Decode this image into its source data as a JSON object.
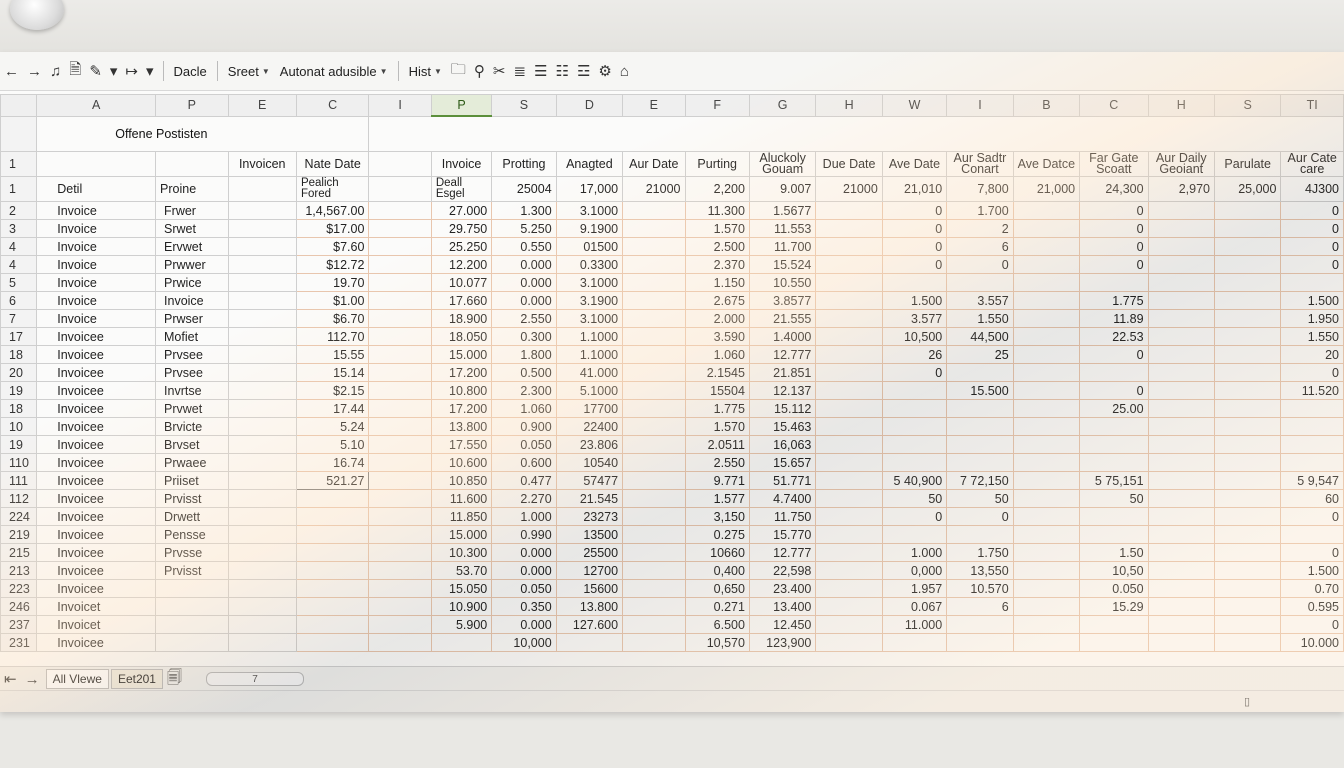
{
  "toolbar": {
    "items": [
      {
        "name": "back-icon",
        "glyph": "←",
        "kind": "icon"
      },
      {
        "name": "forward-icon",
        "glyph": "→",
        "kind": "icon"
      },
      {
        "name": "brush-icon",
        "glyph": "♫",
        "kind": "icon"
      },
      {
        "name": "save-icon",
        "glyph": "🗎",
        "kind": "icon"
      },
      {
        "name": "paint-icon",
        "glyph": "✎",
        "kind": "icon"
      },
      {
        "name": "dropdown-caret-icon",
        "glyph": "▾",
        "kind": "icon"
      },
      {
        "name": "redo-icon",
        "glyph": "↦",
        "kind": "icon"
      },
      {
        "name": "dropdown-caret-icon",
        "glyph": "▾",
        "kind": "icon"
      }
    ],
    "dacle_label": "Dacle",
    "sreet_label": "Sreet",
    "format_label": "Autonat adusible",
    "hist_label": "Hist",
    "icons2": [
      {
        "name": "folder-icon",
        "glyph": "🗀"
      },
      {
        "name": "zoom-icon",
        "glyph": "⚲"
      },
      {
        "name": "clear-icon",
        "glyph": "✂"
      },
      {
        "name": "align-icon",
        "glyph": "≣"
      },
      {
        "name": "list-icon",
        "glyph": "☰"
      },
      {
        "name": "bullets-icon",
        "glyph": "☷"
      },
      {
        "name": "outline-icon",
        "glyph": "☲"
      },
      {
        "name": "link-icon",
        "glyph": "⚙"
      },
      {
        "name": "home-icon",
        "glyph": "⌂"
      }
    ]
  },
  "columns": [
    "A",
    "P",
    "E",
    "C",
    "I",
    "P",
    "S",
    "D",
    "E",
    "F",
    "G",
    "H",
    "W",
    "I",
    "B",
    "C",
    "H",
    "S",
    "TI"
  ],
  "title": "Offene Postisten",
  "header_row": {
    "rownum": "1",
    "cells": [
      "",
      "",
      "Invoicen",
      "Nate Date",
      "",
      "Invoice",
      "Protting",
      "Anagted",
      "Aur Date",
      "Purting",
      "Aluckoly Gouam",
      "Due Date",
      "Ave Date",
      "Aur Sadtr Conart",
      "Ave Datce",
      "Far Gate Scoatt",
      "Aur Daily Geoiant",
      "Parulate",
      "Aur Cate care"
    ]
  },
  "sub_row": {
    "rownum": "1",
    "cells": [
      "Detil",
      "Proine",
      "",
      "Pealich Fored",
      "",
      "Deall Esgel",
      "25004",
      "17,000",
      "21000",
      "2,200",
      "9.007",
      "21000",
      "21,010",
      "7,800",
      "21,000",
      "24,300",
      "2,970",
      "25,000",
      "4J300"
    ]
  },
  "rows": [
    {
      "n": "2",
      "c": [
        "Invoice",
        "Frwer",
        "",
        "1,4,567.00",
        "",
        "27.000",
        "1.300",
        "3.1000",
        "",
        "11.300",
        "1.5677",
        "",
        "0",
        "1.700",
        "",
        "0",
        "",
        "",
        "0"
      ]
    },
    {
      "n": "3",
      "c": [
        "Invoice",
        "Srwet",
        "",
        "$17.00",
        "",
        "29.750",
        "5.250",
        "9.1900",
        "",
        "1.570",
        "11.553",
        "",
        "0",
        "2",
        "",
        "0",
        "",
        "",
        "0"
      ]
    },
    {
      "n": "4",
      "c": [
        "Invoice",
        "Ervwet",
        "",
        "$7.60",
        "",
        "25.250",
        "0.550",
        "01500",
        "",
        "2.500",
        "11.700",
        "",
        "0",
        "6",
        "",
        "0",
        "",
        "",
        "0"
      ]
    },
    {
      "n": "4",
      "c": [
        "Invoice",
        "Prwwer",
        "",
        "$12.72",
        "",
        "12.200",
        "0.000",
        "0.3300",
        "",
        "2.370",
        "15.524",
        "",
        "0",
        "0",
        "",
        "0",
        "",
        "",
        "0"
      ]
    },
    {
      "n": "5",
      "c": [
        "Invoice",
        "Prwice",
        "",
        "19.70",
        "",
        "10.077",
        "0.000",
        "3.1000",
        "",
        "1.150",
        "10.550",
        "",
        "",
        "",
        "",
        "",
        "",
        "",
        ""
      ]
    },
    {
      "n": "6",
      "c": [
        "Invoice",
        "Invoice",
        "",
        "$1.00",
        "",
        "17.660",
        "0.000",
        "3.1900",
        "",
        "2.675",
        "3.8577",
        "",
        "1.500",
        "3.557",
        "",
        "1.775",
        "",
        "",
        "1.500"
      ]
    },
    {
      "n": "7",
      "c": [
        "Invoice",
        "Prwser",
        "",
        "$6.70",
        "",
        "18.900",
        "2.550",
        "3.1000",
        "",
        "2.000",
        "21.555",
        "",
        "3.577",
        "1.550",
        "",
        "11.89",
        "",
        "",
        "1.950"
      ]
    },
    {
      "n": "17",
      "c": [
        "Invoicee",
        "Mofiet",
        "",
        "112.70",
        "",
        "18.050",
        "0.300",
        "1.1000",
        "",
        "3.590",
        "1.4000",
        "",
        "10,500",
        "44,500",
        "",
        "22.53",
        "",
        "",
        "1.550"
      ]
    },
    {
      "n": "18",
      "c": [
        "Invoicee",
        "Prvsee",
        "",
        "15.55",
        "",
        "15.000",
        "1.800",
        "1.1000",
        "",
        "1.060",
        "12.777",
        "",
        "26",
        "25",
        "",
        "0",
        "",
        "",
        "20"
      ]
    },
    {
      "n": "20",
      "c": [
        "Invoicee",
        "Prvsee",
        "",
        "15.14",
        "",
        "17.200",
        "0.500",
        "41.000",
        "",
        "2.1545",
        "21.851",
        "",
        "0",
        "",
        "",
        "",
        "",
        "",
        "0"
      ]
    },
    {
      "n": "19",
      "c": [
        "Invoicee",
        "Invrtse",
        "",
        "$2.15",
        "",
        "10.800",
        "2.300",
        "5.1000",
        "",
        "15504",
        "12.137",
        "",
        "",
        "15.500",
        "",
        "0",
        "",
        "",
        "11.520"
      ]
    },
    {
      "n": "18",
      "c": [
        "Invoicee",
        "Prvwet",
        "",
        "17.44",
        "",
        "17.200",
        "1.060",
        "17700",
        "",
        "1.775",
        "15.112",
        "",
        "",
        "",
        "",
        "25.00",
        "",
        "",
        ""
      ]
    },
    {
      "n": "10",
      "c": [
        "Invoicee",
        "Brvicte",
        "",
        "5.24",
        "",
        "13.800",
        "0.900",
        "22400",
        "",
        "1.570",
        "15.463",
        "",
        "",
        "",
        "",
        "",
        "",
        "",
        ""
      ]
    },
    {
      "n": "19",
      "c": [
        "Invoicee",
        "Brvset",
        "",
        "5.10",
        "",
        "17.550",
        "0.050",
        "23.806",
        "",
        "2.0511",
        "16,063",
        "",
        "",
        "",
        "",
        "",
        "",
        "",
        ""
      ]
    },
    {
      "n": "110",
      "c": [
        "Invoicee",
        "Prwaee",
        "",
        "16.74",
        "",
        "10.600",
        "0.600",
        "10540",
        "",
        "2.550",
        "15.657",
        "",
        "",
        "",
        "",
        "",
        "",
        "",
        ""
      ]
    },
    {
      "n": "111",
      "c": [
        "Invoicee",
        "Priiset",
        "",
        "521.27",
        "",
        "10.850",
        "0.477",
        "57477",
        "",
        "9.771",
        "51.771",
        "",
        "5  40,900",
        "7  72,150",
        "",
        "5  75,151",
        "",
        "",
        "5  9,547"
      ]
    },
    {
      "n": "112",
      "c": [
        "Invoicee",
        "Prvisst",
        "",
        "",
        "",
        "11.600",
        "2.270",
        "21.545",
        "",
        "1.577",
        "4.7400",
        "",
        "50",
        "50",
        "",
        "50",
        "",
        "",
        "60"
      ]
    },
    {
      "n": "224",
      "c": [
        "Invoicee",
        "Drwett",
        "",
        "",
        "",
        "11.850",
        "1.000",
        "23273",
        "",
        "3,150",
        "11.750",
        "",
        "0",
        "0",
        "",
        "",
        "",
        "",
        "0"
      ]
    },
    {
      "n": "219",
      "c": [
        "Invoicee",
        "Pensse",
        "",
        "",
        "",
        "15.000",
        "0.990",
        "13500",
        "",
        "0.275",
        "15.770",
        "",
        "",
        "",
        "",
        "",
        "",
        "",
        ""
      ]
    },
    {
      "n": "215",
      "c": [
        "Invoicee",
        "Prvsse",
        "",
        "",
        "",
        "10.300",
        "0.000",
        "25500",
        "",
        "10660",
        "12.777",
        "",
        "1.000",
        "1.750",
        "",
        "1.50",
        "",
        "",
        "0"
      ]
    },
    {
      "n": "213",
      "c": [
        "Invoicee",
        "Prvisst",
        "",
        "",
        "",
        "53.70",
        "0.000",
        "12700",
        "",
        "0,400",
        "22,598",
        "",
        "0,000",
        "13,550",
        "",
        "10,50",
        "",
        "",
        "1.500"
      ]
    },
    {
      "n": "223",
      "c": [
        "Invoicee",
        "",
        "",
        "",
        "",
        "15.050",
        "0.050",
        "15600",
        "",
        "0,650",
        "23.400",
        "",
        "1.957",
        "10.570",
        "",
        "0.050",
        "",
        "",
        "0.70"
      ]
    },
    {
      "n": "246",
      "c": [
        "Invoicet",
        "",
        "",
        "",
        "",
        "10.900",
        "0.350",
        "13.800",
        "",
        "0.271",
        "13.400",
        "",
        "0.067",
        "6",
        "",
        "15.29",
        "",
        "",
        "0.595"
      ]
    },
    {
      "n": "237",
      "c": [
        "Invoicet",
        "",
        "",
        "",
        "",
        "5.900",
        "0.000",
        "127.600",
        "",
        "6.500",
        "12.450",
        "",
        "11.000",
        "",
        "",
        "",
        "",
        "",
        "0"
      ]
    },
    {
      "n": "231",
      "c": [
        "Invoicee",
        "",
        "",
        "",
        "",
        "",
        "10,000",
        "",
        "",
        "10,570",
        "123,900",
        "",
        "",
        "",
        "",
        "",
        "",
        "",
        "10.000"
      ]
    }
  ],
  "sheet_tabs": [
    "All Vlewe",
    "Eet201"
  ],
  "scroll_label": "7"
}
